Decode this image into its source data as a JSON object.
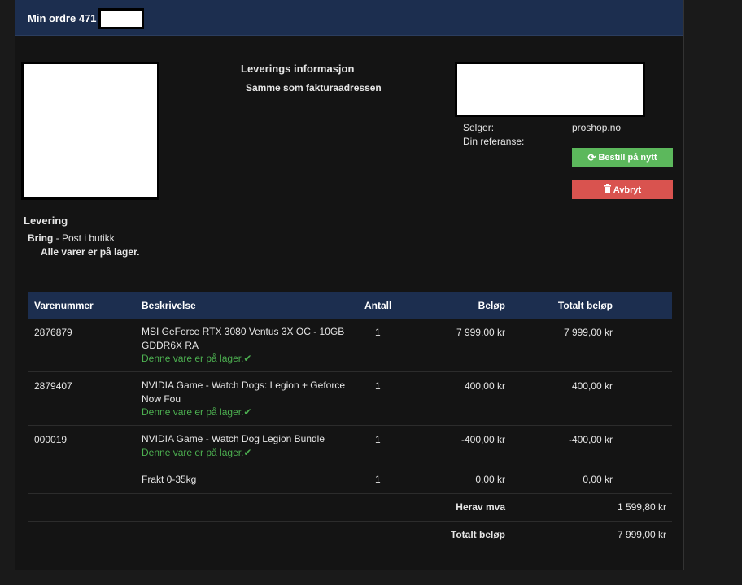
{
  "header": {
    "title": "Min ordre 471"
  },
  "delivery_info": {
    "title": "Leverings informasjon",
    "value": "Samme som fakturaadressen"
  },
  "meta": {
    "seller_label": "Selger:",
    "seller_value": "proshop.no",
    "reference_label": "Din referanse:",
    "reference_value": ""
  },
  "buttons": {
    "reorder_label": "Bestill på nytt",
    "reorder_icon": "refresh-icon",
    "cancel_label": "Avbryt",
    "cancel_icon": "trash-icon",
    "reorder_color": "#5cb85c",
    "cancel_color": "#d9534f"
  },
  "shipping": {
    "title": "Levering",
    "carrier": "Bring",
    "method": " - Post i butikk",
    "stock_note": "Alle varer er på lager."
  },
  "table": {
    "headers": {
      "sku": "Varenummer",
      "description": "Beskrivelse",
      "quantity": "Antall",
      "price": "Beløp",
      "total": "Totalt beløp"
    },
    "rows": [
      {
        "sku": "2876879",
        "description": "MSI GeForce RTX 3080 Ventus 3X OC - 10GB GDDR6X RA",
        "stock": "Denne vare er på lager.",
        "quantity": "1",
        "price": "7 999,00 kr",
        "total": "7 999,00 kr"
      },
      {
        "sku": "2879407",
        "description": "NVIDIA Game - Watch Dogs: Legion + Geforce Now Fou",
        "stock": "Denne vare er på lager.",
        "quantity": "1",
        "price": "400,00 kr",
        "total": "400,00 kr"
      },
      {
        "sku": "000019",
        "description": "NVIDIA Game - Watch Dog Legion Bundle",
        "stock": "Denne vare er på lager.",
        "quantity": "1",
        "price": "-400,00 kr",
        "total": "-400,00 kr"
      },
      {
        "sku": "",
        "description": "Frakt 0-35kg",
        "stock": "",
        "quantity": "1",
        "price": "0,00 kr",
        "total": "0,00 kr"
      }
    ],
    "summary": {
      "vat_label": "Herav mva",
      "vat_value": "1 599,80 kr",
      "total_label": "Totalt beløp",
      "total_value": "7 999,00 kr"
    }
  },
  "colors": {
    "header_bg": "#1c2e4f",
    "stock_ok": "#4caf50"
  }
}
